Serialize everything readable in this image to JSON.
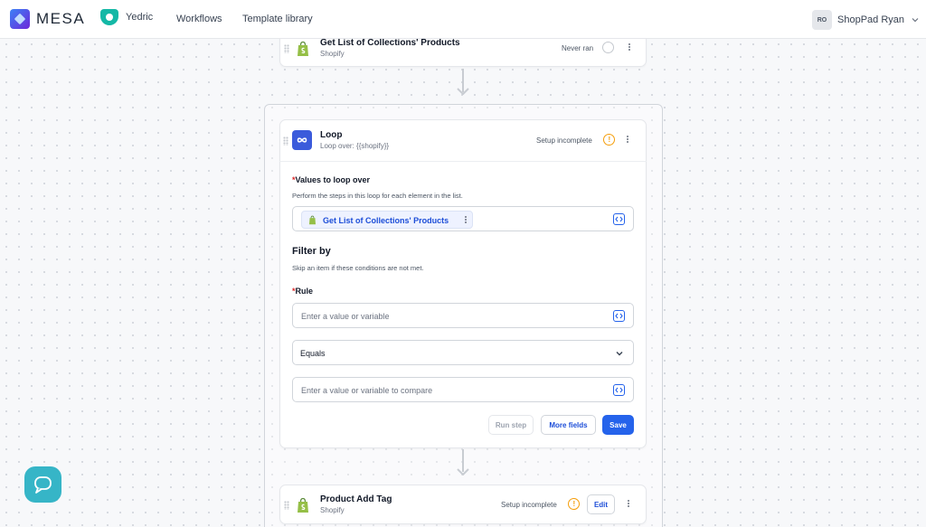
{
  "nav": {
    "brand": "MESA",
    "workspace": "Yedric",
    "links": [
      "Workflows",
      "Template library"
    ],
    "user_initials": "RO",
    "user_name": "ShopPad Ryan"
  },
  "steps": {
    "get_collections": {
      "title": "Get List of Collections' Products",
      "subtitle": "Shopify",
      "status": "Never ran"
    },
    "loop": {
      "title": "Loop",
      "subtitle": "Loop over: {{shopify}}",
      "status": "Setup incomplete",
      "values_label": "Values to loop over",
      "values_help": "Perform the steps in this loop for each element in the list.",
      "values_chip": "Get List of Collections' Products",
      "filter_title": "Filter by",
      "filter_help": "Skip an item if these conditions are not met.",
      "rule_label": "Rule",
      "rule_placeholder": "Enter a value or variable",
      "operator_value": "Equals",
      "compare_placeholder": "Enter a value or variable to compare",
      "buttons": {
        "run_step": "Run step",
        "more_fields": "More fields",
        "save": "Save"
      }
    },
    "product_add_tag": {
      "title": "Product Add Tag",
      "subtitle": "Shopify",
      "status": "Setup incomplete",
      "edit_label": "Edit"
    }
  },
  "required_mark": "*",
  "warning_mark": "!",
  "colors": {
    "primary": "#2563eb",
    "warning": "#f59e0b",
    "required": "#dc2626",
    "shopify": "#95bf47",
    "loop_icon": "#3b5bdb",
    "chat": "#36b5c7"
  }
}
